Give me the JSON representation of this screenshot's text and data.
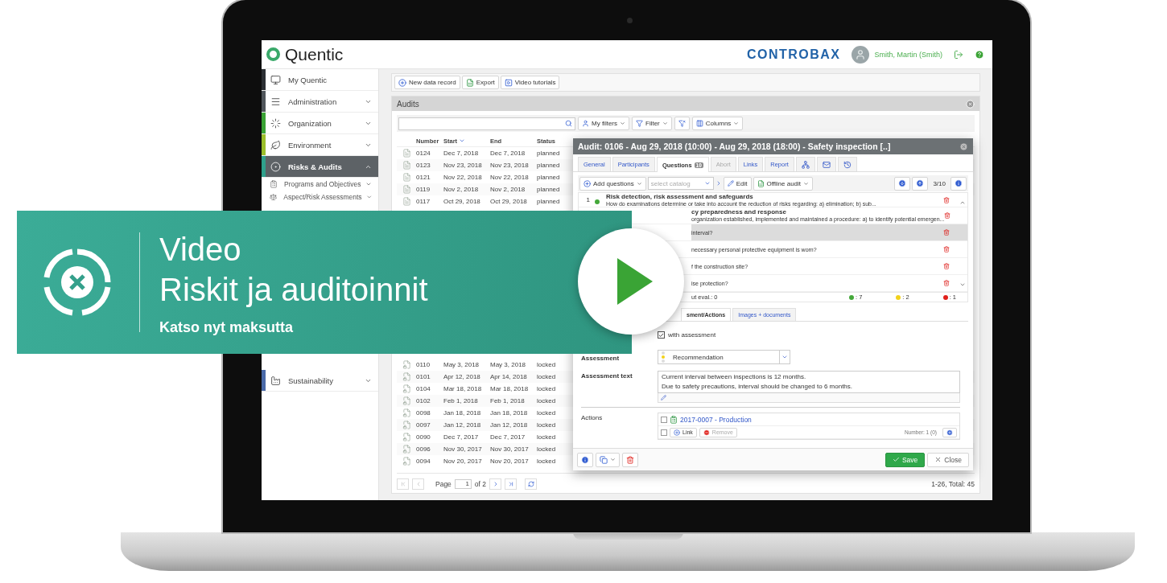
{
  "header": {
    "logo": "Quentic",
    "partner_logo": "CONTROBAX",
    "user": "Smith, Martin (Smith)"
  },
  "sidebar": {
    "items": [
      {
        "label": "My Quentic",
        "color": "#2b2f33",
        "selected": false,
        "kind": "link"
      },
      {
        "label": "Administration",
        "color": "#50565b",
        "selected": false,
        "expanded": false,
        "kind": "group"
      },
      {
        "label": "Organization",
        "color": "#3aa335",
        "selected": false,
        "expanded": false,
        "kind": "group"
      },
      {
        "label": "Environment",
        "color": "#9cbf2b",
        "selected": false,
        "expanded": false,
        "kind": "group"
      },
      {
        "label": "Risks & Audits",
        "color": "#2fa08b",
        "selected": true,
        "expanded": true,
        "kind": "group",
        "children": [
          {
            "label": "Programs and Objectives",
            "expanded": false
          },
          {
            "label": "Aspect/Risk Assessments",
            "expanded": false
          }
        ]
      },
      {
        "label": "Sustainability",
        "color": "#4a6aa8",
        "selected": false,
        "expanded": false,
        "kind": "group"
      }
    ]
  },
  "toolbar": [
    "New data record",
    "Export",
    "Video tutorials"
  ],
  "panel": {
    "title": "Audits",
    "filters": [
      "My filters",
      "Filter",
      "Columns"
    ]
  },
  "table": {
    "columns": [
      {
        "label": "Number",
        "sorted": false
      },
      {
        "label": "Start",
        "sorted": true
      },
      {
        "label": "End",
        "sorted": false
      },
      {
        "label": "Status",
        "sorted": false
      }
    ],
    "rows": [
      {
        "number": "0124",
        "start": "Dec 7, 2018",
        "end": "Dec 7, 2018",
        "status": "planned",
        "locked": false
      },
      {
        "number": "0123",
        "start": "Nov 23, 2018",
        "end": "Nov 23, 2018",
        "status": "planned",
        "locked": false
      },
      {
        "number": "0121",
        "start": "Nov 22, 2018",
        "end": "Nov 22, 2018",
        "status": "planned",
        "locked": false
      },
      {
        "number": "0119",
        "start": "Nov 2, 2018",
        "end": "Nov 2, 2018",
        "status": "planned",
        "locked": false
      },
      {
        "number": "0117",
        "start": "Oct 29, 2018",
        "end": "Oct 29, 2018",
        "status": "planned",
        "locked": false
      }
    ],
    "rows_below_banner": [
      {
        "number": "0110",
        "start": "May 3, 2018",
        "end": "May 3, 2018",
        "status": "locked",
        "locked": true
      },
      {
        "number": "0101",
        "start": "Apr 12, 2018",
        "end": "Apr 14, 2018",
        "status": "locked",
        "locked": true
      },
      {
        "number": "0104",
        "start": "Mar 18, 2018",
        "end": "Mar 18, 2018",
        "status": "locked",
        "locked": true
      },
      {
        "number": "0102",
        "start": "Feb 1, 2018",
        "end": "Feb 1, 2018",
        "status": "locked",
        "locked": true
      },
      {
        "number": "0098",
        "start": "Jan 18, 2018",
        "end": "Jan 18, 2018",
        "status": "locked",
        "locked": true
      },
      {
        "number": "0097",
        "start": "Jan 12, 2018",
        "end": "Jan 12, 2018",
        "status": "locked",
        "locked": true
      },
      {
        "number": "0090",
        "start": "Dec 7, 2017",
        "end": "Dec 7, 2017",
        "status": "locked",
        "locked": true
      },
      {
        "number": "0096",
        "start": "Nov 30, 2017",
        "end": "Nov 30, 2017",
        "status": "locked",
        "locked": true
      },
      {
        "number": "0094",
        "start": "Nov 20, 2017",
        "end": "Nov 20, 2017",
        "status": "locked",
        "locked": true
      }
    ]
  },
  "pager": {
    "label": "Page",
    "page": "1",
    "total": "of 2",
    "range": "1-26, Total: 45"
  },
  "dialog": {
    "title": "Audit: 0106 - Aug 29, 2018 (10:00) - Aug 29, 2018 (18:00) - Safety inspection [..]",
    "tabs": [
      {
        "label": "General",
        "selected": false,
        "disabled": false
      },
      {
        "label": "Participants",
        "selected": false,
        "disabled": false
      },
      {
        "label": "Questions",
        "badge": "10",
        "selected": true,
        "disabled": false
      },
      {
        "label": "Abort",
        "selected": false,
        "disabled": true
      },
      {
        "label": "Links",
        "selected": false,
        "disabled": false
      },
      {
        "label": "Report",
        "selected": false,
        "disabled": false
      }
    ],
    "toolbar": {
      "add": "Add questions",
      "catalog_placeholder": "select catalog",
      "edit": "Edit",
      "offline": "Offline audit",
      "counter": "3/10"
    },
    "questions": [
      {
        "number": "1",
        "title": "Risk detection, risk assessment and safeguards",
        "text": "How do examinations determine or take into account the reduction of risks regarding: a) elimination; b) sub...",
        "color": "#44a83a",
        "selected": false
      },
      {
        "title": "cy preparedness and response",
        "text": "organization established, implemented and maintained a procedure: a) to identify potential emergen...",
        "selected": false
      },
      {
        "text": "interval?",
        "selected": true
      },
      {
        "text": "necessary personal protective equipment is worn?",
        "selected": false
      },
      {
        "text": "f the construction site?",
        "selected": false
      },
      {
        "text": "ise protection?",
        "selected": false
      }
    ],
    "summary": {
      "unevaluated": "ut eval.: 0",
      "counts": [
        {
          "color": "#44a83a",
          "text": ": 7"
        },
        {
          "color": "#f2d21b",
          "text": ": 2"
        },
        {
          "color": "#e0201b",
          "text": ": 1"
        }
      ]
    },
    "subtabs": [
      {
        "label": "sment/Actions",
        "selected": true
      },
      {
        "label": "Images + documents",
        "selected": false
      }
    ],
    "assessment": {
      "checkbox_label": "with assessment",
      "checked": true,
      "label": "Assessment",
      "value": "Recommendation",
      "text_label": "Assessment text",
      "text": "Current interval between inspections is 12 months.\nDue to safety precautions, interval should be changed to 6 months."
    },
    "actions": {
      "label": "Actions",
      "items": [
        {
          "label": "2017-0007 - Production",
          "checked": false
        }
      ],
      "select_all_checked": false,
      "link": "Link",
      "remove": "Remove",
      "count": "Number: 1 (0)"
    },
    "footer": {
      "save": "Save",
      "close": "Close"
    }
  },
  "banner": {
    "lines": [
      "Video",
      "Riskit ja auditoinnit"
    ],
    "subtitle": "Katso nyt maksutta"
  }
}
